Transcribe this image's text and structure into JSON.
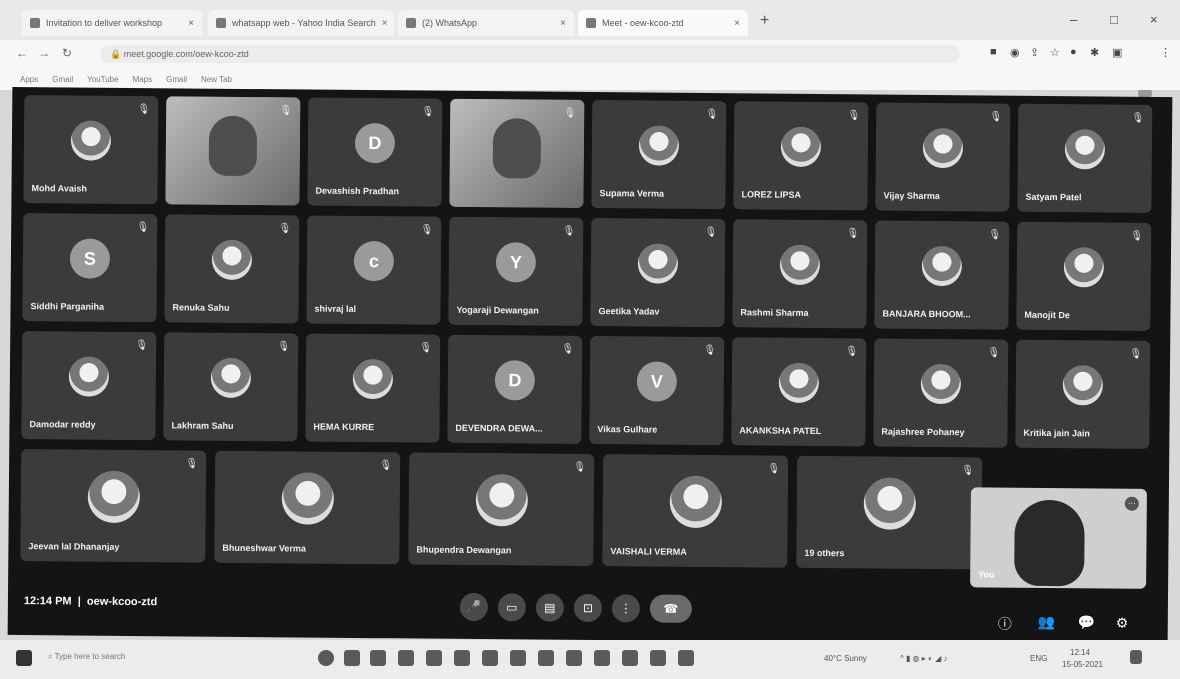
{
  "browser": {
    "tabs": [
      {
        "label": "Invitation to deliver workshop"
      },
      {
        "label": "whatsapp web - Yahoo India Search"
      },
      {
        "label": "(2) WhatsApp"
      },
      {
        "label": "Meet - oew-kcoo-ztd"
      }
    ],
    "url": "meet.google.com/oew-kcoo-ztd",
    "bookmarks": [
      "Apps",
      "Gmail",
      "YouTube",
      "Maps",
      "Gmail",
      "New Tab"
    ]
  },
  "meet": {
    "time": "12:14 PM",
    "code": "oew-kcoo-ztd",
    "self_label": "You",
    "row1": [
      {
        "name": "Mohd Avaish",
        "type": "photo"
      },
      {
        "name": "",
        "type": "video"
      },
      {
        "name": "Devashish Pradhan",
        "type": "letter",
        "letter": "D"
      },
      {
        "name": "",
        "type": "video"
      },
      {
        "name": "Supama Verma",
        "type": "photo"
      },
      {
        "name": "LOREZ LIPSA",
        "type": "photo"
      },
      {
        "name": "Vijay Sharma",
        "type": "photo"
      },
      {
        "name": "Satyam Patel",
        "type": "photo"
      }
    ],
    "row2": [
      {
        "name": "Siddhi Parganiha",
        "type": "letter",
        "letter": "S"
      },
      {
        "name": "Renuka Sahu",
        "type": "photo"
      },
      {
        "name": "shivraj lal",
        "type": "letter",
        "letter": "c"
      },
      {
        "name": "Yogaraji Dewangan",
        "type": "letter",
        "letter": "Y"
      },
      {
        "name": "Geetika Yadav",
        "type": "photo"
      },
      {
        "name": "Rashmi Sharma",
        "type": "photo"
      },
      {
        "name": "BANJARA BHOOM...",
        "type": "photo"
      },
      {
        "name": "Manojit De",
        "type": "photo"
      }
    ],
    "row3": [
      {
        "name": "Damodar reddy",
        "type": "photo"
      },
      {
        "name": "Lakhram Sahu",
        "type": "photo"
      },
      {
        "name": "HEMA KURRE",
        "type": "photo"
      },
      {
        "name": "DEVENDRA DEWA...",
        "type": "letter",
        "letter": "D"
      },
      {
        "name": "Vikas Gulhare",
        "type": "letter",
        "letter": "V"
      },
      {
        "name": "AKANKSHA PATEL",
        "type": "photo"
      },
      {
        "name": "Rajashree Pohaney",
        "type": "photo"
      },
      {
        "name": "Kritika jain Jain",
        "type": "photo"
      }
    ],
    "row4": [
      {
        "name": "Jeevan lal Dhananjay",
        "type": "photo"
      },
      {
        "name": "Bhuneshwar Verma",
        "type": "photo"
      },
      {
        "name": "Bhupendra Dewangan",
        "type": "photo"
      },
      {
        "name": "VAISHALI VERMA",
        "type": "photo"
      },
      {
        "name": "19 others",
        "type": "photo"
      }
    ]
  },
  "taskbar": {
    "search_placeholder": "Type here to search",
    "weather": "40°C Sunny",
    "lang": "ENG",
    "clock_time": "12:14",
    "clock_date": "15-05-2021"
  }
}
